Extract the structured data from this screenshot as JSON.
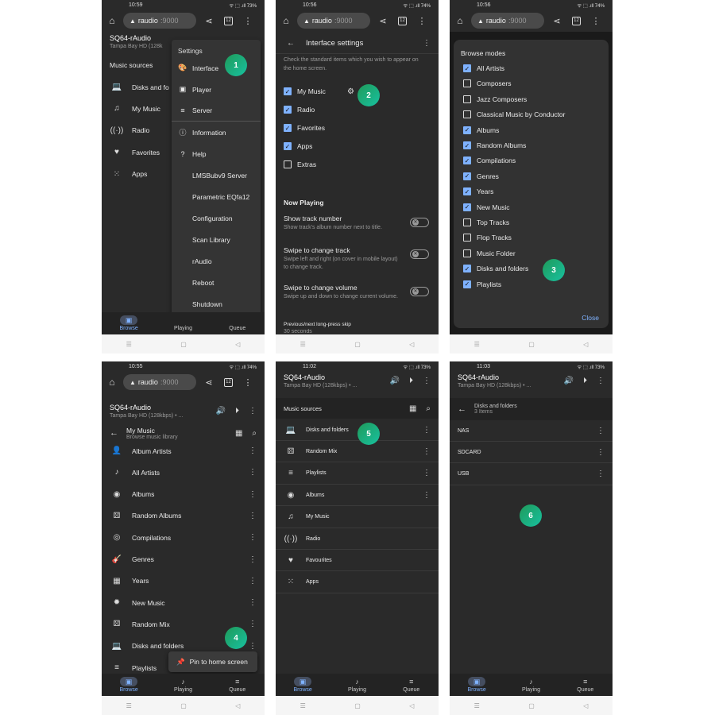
{
  "urlbar": {
    "host": "raudio",
    "port": ":9000",
    "tabs": "12"
  },
  "badges": [
    "1",
    "2",
    "3",
    "4",
    "5",
    "6"
  ],
  "sysbar": {
    "recent": "☰",
    "home": "▢",
    "back": "◁"
  },
  "nav": {
    "browse": "Browse",
    "playing": "Playing",
    "queue": "Queue"
  },
  "p1": {
    "time": "10:59",
    "status": "ᯤ ⬚ .ıll 73%",
    "title": "SQ64-rAudio",
    "subtitle": "Tampa Bay HD (128k",
    "sources_label": "Music sources",
    "items": [
      {
        "icon": "laptop-icon",
        "glyph": "💻",
        "label": "Disks and fo"
      },
      {
        "icon": "music-library-icon",
        "glyph": "♫",
        "label": "My Music"
      },
      {
        "icon": "radio-icon",
        "glyph": "((·))",
        "label": "Radio"
      },
      {
        "icon": "heart-icon",
        "glyph": "♥",
        "label": "Favorites"
      },
      {
        "icon": "apps-icon",
        "glyph": "⁙",
        "label": "Apps"
      }
    ],
    "menu": {
      "heading": "Settings",
      "items": [
        {
          "icon": "palette-icon",
          "glyph": "🎨",
          "label": "Interface"
        },
        {
          "icon": "player-settings-icon",
          "glyph": "▣",
          "label": "Player"
        },
        {
          "icon": "server-icon",
          "glyph": "≡",
          "label": "Server"
        },
        {
          "icon": "info-icon",
          "glyph": "ⓘ",
          "label": "Information"
        },
        {
          "icon": "help-icon",
          "glyph": "?",
          "label": "Help"
        }
      ],
      "sub": [
        "LMSBubv9 Server",
        "Parametric EQfa12",
        "Configuration",
        "Scan Library",
        "rAudio",
        "Reboot",
        "Shutdown"
      ]
    }
  },
  "p2": {
    "time": "10:56",
    "status": "ᯤ ⬚ .ıll 74%",
    "title": "Interface settings",
    "desc": "Check the standard items which you wish to appear on the home screen.",
    "checks": [
      {
        "label": "My Music",
        "on": true
      },
      {
        "label": "Radio",
        "on": true
      },
      {
        "label": "Favorites",
        "on": true
      },
      {
        "label": "Apps",
        "on": true
      },
      {
        "label": "Extras",
        "on": false
      }
    ],
    "now_playing": "Now Playing",
    "settings": [
      {
        "title": "Show track number",
        "desc": "Show track's album number next to title."
      },
      {
        "title": "Swipe to change track",
        "desc": "Swipe left and right (on cover in mobile layout) to change track."
      },
      {
        "title": "Swipe to change volume",
        "desc": "Swipe up and down to change current volume."
      }
    ],
    "skip": "Previous/next long-press skip",
    "skip_value": "30 seconds"
  },
  "p3": {
    "time": "10:56",
    "status": "ᯤ ⬚ .ıll 74%",
    "title": "Browse modes",
    "modes": [
      {
        "label": "All Artists",
        "on": true
      },
      {
        "label": "Composers",
        "on": false
      },
      {
        "label": "Jazz Composers",
        "on": false
      },
      {
        "label": "Classical Music by Conductor",
        "on": false
      },
      {
        "label": "Albums",
        "on": true
      },
      {
        "label": "Random Albums",
        "on": true
      },
      {
        "label": "Compilations",
        "on": true
      },
      {
        "label": "Genres",
        "on": true
      },
      {
        "label": "Years",
        "on": true
      },
      {
        "label": "New Music",
        "on": true
      },
      {
        "label": "Top Tracks",
        "on": false
      },
      {
        "label": "Flop Tracks",
        "on": false
      },
      {
        "label": "Music Folder",
        "on": false
      },
      {
        "label": "Disks and folders",
        "on": true
      },
      {
        "label": "Playlists",
        "on": true
      }
    ],
    "close": "Close"
  },
  "p4": {
    "time": "10:55",
    "status": "ᯤ ⬚ .ıll 74%",
    "title": "SQ64-rAudio",
    "subtitle": "Tampa Bay HD (128kbps) • ...",
    "vol": "50%",
    "sub_title": "My Music",
    "sub_sub": "Browse music library",
    "items": [
      {
        "icon": "album-artists-icon",
        "glyph": "👤",
        "label": "Album Artists"
      },
      {
        "icon": "artists-icon",
        "glyph": "♪",
        "label": "All Artists"
      },
      {
        "icon": "album-icon",
        "glyph": "◉",
        "label": "Albums"
      },
      {
        "icon": "random-albums-icon",
        "glyph": "⚄",
        "label": "Random Albums"
      },
      {
        "icon": "compilations-icon",
        "glyph": "◎",
        "label": "Compilations"
      },
      {
        "icon": "guitar-icon",
        "glyph": "🎸",
        "label": "Genres"
      },
      {
        "icon": "calendar-icon",
        "glyph": "▦",
        "label": "Years"
      },
      {
        "icon": "new-music-icon",
        "glyph": "✹",
        "label": "New Music"
      },
      {
        "icon": "random-mix-icon",
        "glyph": "⚄",
        "label": "Random Mix"
      },
      {
        "icon": "laptop-icon",
        "glyph": "💻",
        "label": "Disks and folders"
      },
      {
        "icon": "playlist-icon",
        "glyph": "≡",
        "label": "Playlists"
      }
    ],
    "popup": "Pin to home screen"
  },
  "p5": {
    "time": "11:02",
    "status": "ᯤ ⬚ .ıll 73%",
    "title": "SQ64-rAudio",
    "subtitle": "Tampa Bay HD (128kbps) • ...",
    "vol": "50%",
    "sources_label": "Music sources",
    "items": [
      {
        "icon": "laptop-icon",
        "glyph": "💻",
        "label": "Disks and folders",
        "more": true
      },
      {
        "icon": "random-mix-icon",
        "glyph": "⚄",
        "label": "Random Mix",
        "more": true
      },
      {
        "icon": "playlist-icon",
        "glyph": "≡",
        "label": "Playlists",
        "more": true
      },
      {
        "icon": "album-icon",
        "glyph": "◉",
        "label": "Albums",
        "more": true
      },
      {
        "icon": "music-library-icon",
        "glyph": "♫",
        "label": "My Music",
        "more": false
      },
      {
        "icon": "radio-icon",
        "glyph": "((·))",
        "label": "Radio",
        "more": false
      },
      {
        "icon": "heart-icon",
        "glyph": "♥",
        "label": "Favourites",
        "more": false
      },
      {
        "icon": "apps-icon",
        "glyph": "⁙",
        "label": "Apps",
        "more": false
      }
    ]
  },
  "p6": {
    "time": "11:03",
    "status": "ᯤ ⬚ .ıll 73%",
    "title": "SQ64-rAudio",
    "subtitle": "Tampa Bay HD (128kbps) • ...",
    "vol": "50%",
    "sub_title": "Disks and folders",
    "sub_sub": "3 Items",
    "items": [
      "NAS",
      "SDCARD",
      "USB"
    ]
  }
}
